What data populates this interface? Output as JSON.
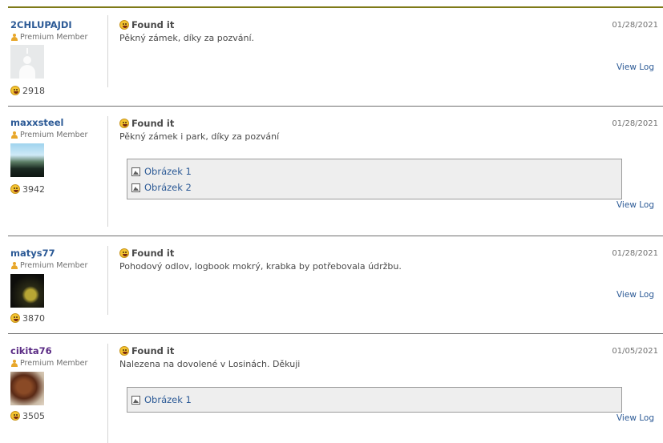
{
  "logs": [
    {
      "username": "2CHLUPAJDI",
      "member_type": "Premium Member",
      "score": "2918",
      "log_type": "Found it",
      "date": "01/28/2021",
      "text": "Pěkný zámek, díky za pozvání.",
      "images": [],
      "view_log": "View Log"
    },
    {
      "username": "maxxsteel",
      "member_type": "Premium Member",
      "score": "3942",
      "log_type": "Found it",
      "date": "01/28/2021",
      "text": "Pěkný zámek i park, díky za pozvání",
      "images": [
        "Obrázek 1",
        "Obrázek 2"
      ],
      "view_log": "View Log"
    },
    {
      "username": "matys77",
      "member_type": "Premium Member",
      "score": "3870",
      "log_type": "Found it",
      "date": "01/28/2021",
      "text": "Pohodový odlov, logbook mokrý, krabka by potřebovala údržbu.",
      "images": [],
      "view_log": "View Log"
    },
    {
      "username": "cikita76",
      "member_type": "Premium Member",
      "score": "3505",
      "log_type": "Found it",
      "date": "01/05/2021",
      "text": "Nalezena na dovolené v Losinách. Děkuji",
      "images": [
        "Obrázek 1"
      ],
      "view_log": "View Log"
    }
  ]
}
